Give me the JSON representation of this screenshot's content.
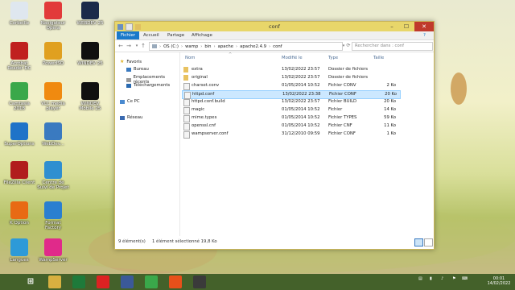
{
  "desktop": {
    "icons": [
      {
        "label": "Corbeille",
        "color": "#dfe7ef"
      },
      {
        "label": "Navigateur Opera",
        "color": "#e23a3a"
      },
      {
        "label": "WEBDEV 25",
        "color": "#1b2a4a"
      },
      {
        "label": "Acrobat Reader DC",
        "color": "#c0201f"
      },
      {
        "label": "PowerISO",
        "color": "#e0a020"
      },
      {
        "label": "WINDEV 25",
        "color": "#101010"
      },
      {
        "label": "Camtasia 2018",
        "color": "#3aa84a"
      },
      {
        "label": "VLC media player",
        "color": "#f08a10"
      },
      {
        "label": "WINDEV Mobile 25",
        "color": "#101010"
      },
      {
        "label": "SuperOptions",
        "color": "#1f73c8"
      },
      {
        "label": "WebDev...",
        "color": "#3a7ac0"
      },
      {
        "label": "FileZilla Client",
        "color": "#b11d1d"
      },
      {
        "label": "Centre de Suivi de Projet",
        "color": "#2f8fd0"
      },
      {
        "label": "K Option",
        "color": "#e86a14"
      },
      {
        "label": "Format Factory",
        "color": "#2a7fd0"
      },
      {
        "label": "Langues",
        "color": "#2d9ad8"
      },
      {
        "label": "WampServer",
        "color": "#e02a8a"
      }
    ]
  },
  "window": {
    "title": "conf",
    "ribbon_tabs": [
      "Fichier",
      "Accueil",
      "Partage",
      "Affichage"
    ],
    "path": [
      "OS (C:)",
      "wamp",
      "bin",
      "apache",
      "apache2.4.9",
      "conf"
    ],
    "search_placeholder": "Rechercher dans : conf",
    "nav": {
      "favoris": "Favoris",
      "bureau": "Bureau",
      "emplacements": "Emplacements récents",
      "telechargements": "Téléchargements",
      "cepc": "Ce PC",
      "reseau": "Réseau"
    },
    "columns": [
      "Nom",
      "Modifié le",
      "Type",
      "Taille"
    ],
    "files": [
      {
        "name": "extra",
        "date": "13/02/2022 23:57",
        "type": "Dossier de fichiers",
        "size": "",
        "folder": true
      },
      {
        "name": "original",
        "date": "13/02/2022 23:57",
        "type": "Dossier de fichiers",
        "size": "",
        "folder": true
      },
      {
        "name": "charset.conv",
        "date": "01/05/2014 10:52",
        "type": "Fichier CONV",
        "size": "2 Ko",
        "folder": false
      },
      {
        "name": "httpd.conf",
        "date": "13/02/2022 23:38",
        "type": "Fichier CONF",
        "size": "20 Ko",
        "folder": false,
        "selected": true
      },
      {
        "name": "httpd.conf.build",
        "date": "13/02/2022 23:57",
        "type": "Fichier BUILD",
        "size": "20 Ko",
        "folder": false
      },
      {
        "name": "magic",
        "date": "01/05/2014 10:52",
        "type": "Fichier",
        "size": "14 Ko",
        "folder": false
      },
      {
        "name": "mime.types",
        "date": "01/05/2014 10:52",
        "type": "Fichier TYPES",
        "size": "59 Ko",
        "folder": false
      },
      {
        "name": "openssl.cnf",
        "date": "01/05/2014 10:52",
        "type": "Fichier CNF",
        "size": "11 Ko",
        "folder": false
      },
      {
        "name": "wampserver.conf",
        "date": "31/12/2010 09:59",
        "type": "Fichier CONF",
        "size": "1 Ko",
        "folder": false
      }
    ],
    "status": {
      "count": "9 élément(s)",
      "selection": "1 élément sélectionné  19,8 Ko"
    }
  },
  "taskbar": {
    "time": "00:01",
    "date": "14/02/2022",
    "apps": [
      {
        "name": "explorer",
        "color": "#d8b040"
      },
      {
        "name": "excel",
        "color": "#1e7a3a"
      },
      {
        "name": "opera",
        "color": "#d22"
      },
      {
        "name": "facebook",
        "color": "#3b5998"
      },
      {
        "name": "camtasia",
        "color": "#3aa84a"
      },
      {
        "name": "recorder",
        "color": "#e8501a"
      },
      {
        "name": "sublime",
        "color": "#3a3a3a"
      }
    ]
  }
}
